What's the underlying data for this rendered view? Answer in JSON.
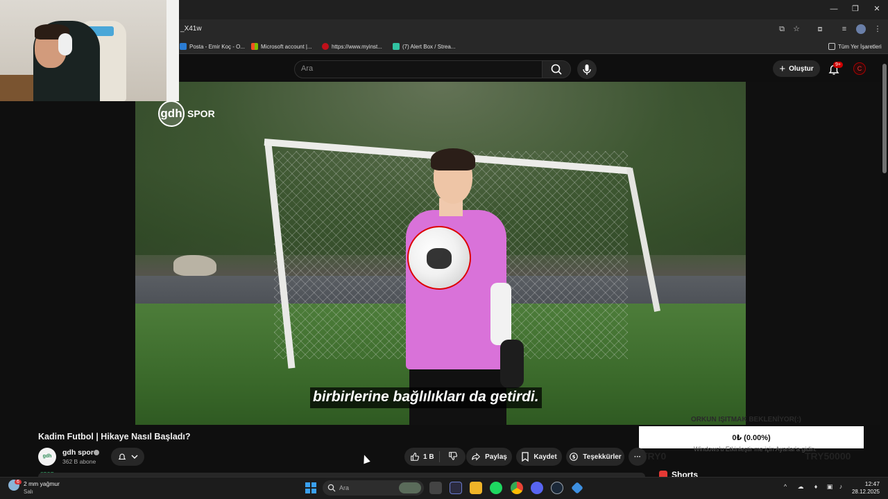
{
  "browser": {
    "url_fragment": "X41w",
    "window_controls": [
      "minimize-icon",
      "restore-icon",
      "close-icon"
    ],
    "bookmarks": [
      {
        "label": "Posta - Emir Koç - O...",
        "icon": "outlook-icon",
        "color": "#2b7cd3"
      },
      {
        "label": "Microsoft account |...",
        "icon": "microsoft-icon",
        "color": "#f25022"
      },
      {
        "label": "https://www.myinst...",
        "icon": "myinstants-icon",
        "color": "#c0101a"
      },
      {
        "label": "(7) Alert Box / Strea...",
        "icon": "streamlabs-icon",
        "color": "#31c3a2"
      }
    ],
    "bookmarks_folder": "Tüm Yer İşaretleri"
  },
  "youtube": {
    "search_placeholder": "Ara",
    "create_label": "Oluştur",
    "notification_count": "9+",
    "video": {
      "channel_watermark_logo": "gdh",
      "channel_watermark_text": "SPOR",
      "subtitle": "birbirlerine bağlılıkları da getirdi.",
      "title": "Kadim Futbol | Hikaye Nasıl Başladı?"
    },
    "channel": {
      "avatar_text": "gdh SPOR",
      "name": "gdh spor",
      "subscribers": "362 B abone"
    },
    "actions": {
      "likes": "1 B",
      "share": "Paylaş",
      "save": "Kaydet",
      "thanks": "Teşekkürler",
      "more": "···"
    },
    "sidebar": {
      "shorts_label": "Shorts"
    }
  },
  "stream_overlay": {
    "goal_title": "ORKUN IŞITMAK BEKLENİYOR(:)",
    "donation_progress": "0₺ (0.00%)",
    "progress_fraction": 0.0,
    "ghost_text": "Windows'u Etkinleştir me için Ayarlar'a gidin.",
    "goal_start": "TRY0",
    "goal_end": "TRY50000"
  },
  "taskbar": {
    "weather_badge": "6",
    "weather_line1": "2 mm yağmur",
    "weather_line2": "Salı",
    "search_placeholder": "Ara",
    "apps": [
      {
        "name": "file-explorer-icon",
        "color": "#f0b428"
      },
      {
        "name": "spotify-icon",
        "color": "#1ed760"
      },
      {
        "name": "chrome-icon",
        "color": "#3c8cf0"
      },
      {
        "name": "discord-icon",
        "color": "#5865f2"
      },
      {
        "name": "steam-icon",
        "color": "#9aa3ad"
      },
      {
        "name": "vscode-icon",
        "color": "#3d8fe0"
      }
    ],
    "time": "12:47",
    "date": "28.12.2025"
  }
}
